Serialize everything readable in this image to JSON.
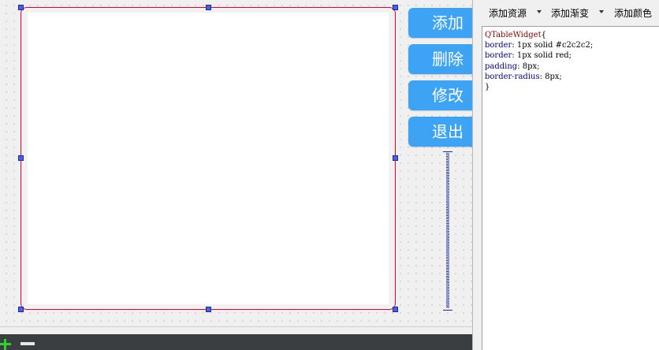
{
  "buttons": {
    "add": "添加",
    "delete": "删除",
    "modify": "修改",
    "exit": "退出"
  },
  "editor": {
    "toolbar": {
      "add_resource": "添加资源",
      "add_gradient": "添加渐变",
      "add_color": "添加颜色"
    },
    "code": {
      "line1_class": "QTableWidget",
      "line1_brace": "{",
      "line2_prop": "border",
      "line2_value": ": 1px solid #c2c2c2;",
      "line3_prop": "border",
      "line3_value": ": 1px solid red;",
      "line4_prop": "padding",
      "line4_value": ": 8px;",
      "line5_prop": "border-radius",
      "line5_value": ": 8px;",
      "line6": "}"
    }
  },
  "colors": {
    "button_bg": "#3ca3f5",
    "selection_border": "#e8002a",
    "handle": "#4a5ee8"
  },
  "icons": {
    "add": "plus-icon",
    "remove": "minus-icon"
  }
}
